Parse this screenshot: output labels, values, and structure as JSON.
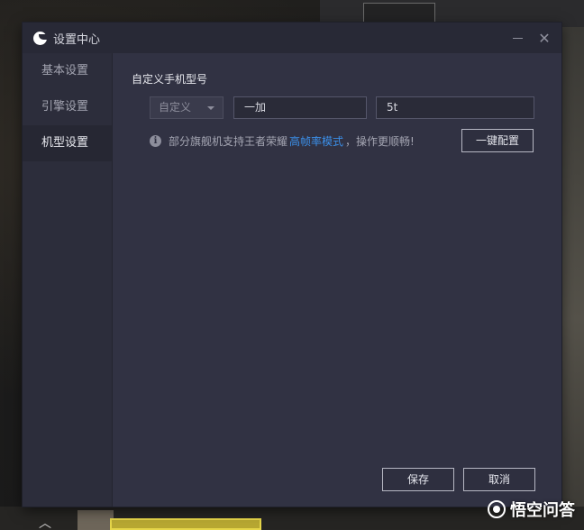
{
  "window": {
    "title": "设置中心",
    "minimize_icon": "minimize-icon",
    "close_icon": "close-icon",
    "close_glyph": "✕"
  },
  "sidebar": {
    "items": [
      {
        "label": "基本设置",
        "active": false
      },
      {
        "label": "引擎设置",
        "active": false
      },
      {
        "label": "机型设置",
        "active": true
      }
    ]
  },
  "content": {
    "section_title": "自定义手机型号",
    "select_value": "自定义",
    "brand_value": "一加",
    "model_value": "5t",
    "info_icon_glyph": "i",
    "info_text_before": "部分旗舰机支持王者荣耀",
    "info_link": "高帧率模式",
    "info_text_after": "，操作更顺畅!",
    "onekey_label": "一键配置",
    "save_label": "保存",
    "cancel_label": "取消"
  },
  "watermark": {
    "text": "悟空问答"
  },
  "background": {
    "up_arrow_glyph": "︿"
  },
  "colors": {
    "window_bg": "#2f3040",
    "link": "#3b8fe8"
  }
}
